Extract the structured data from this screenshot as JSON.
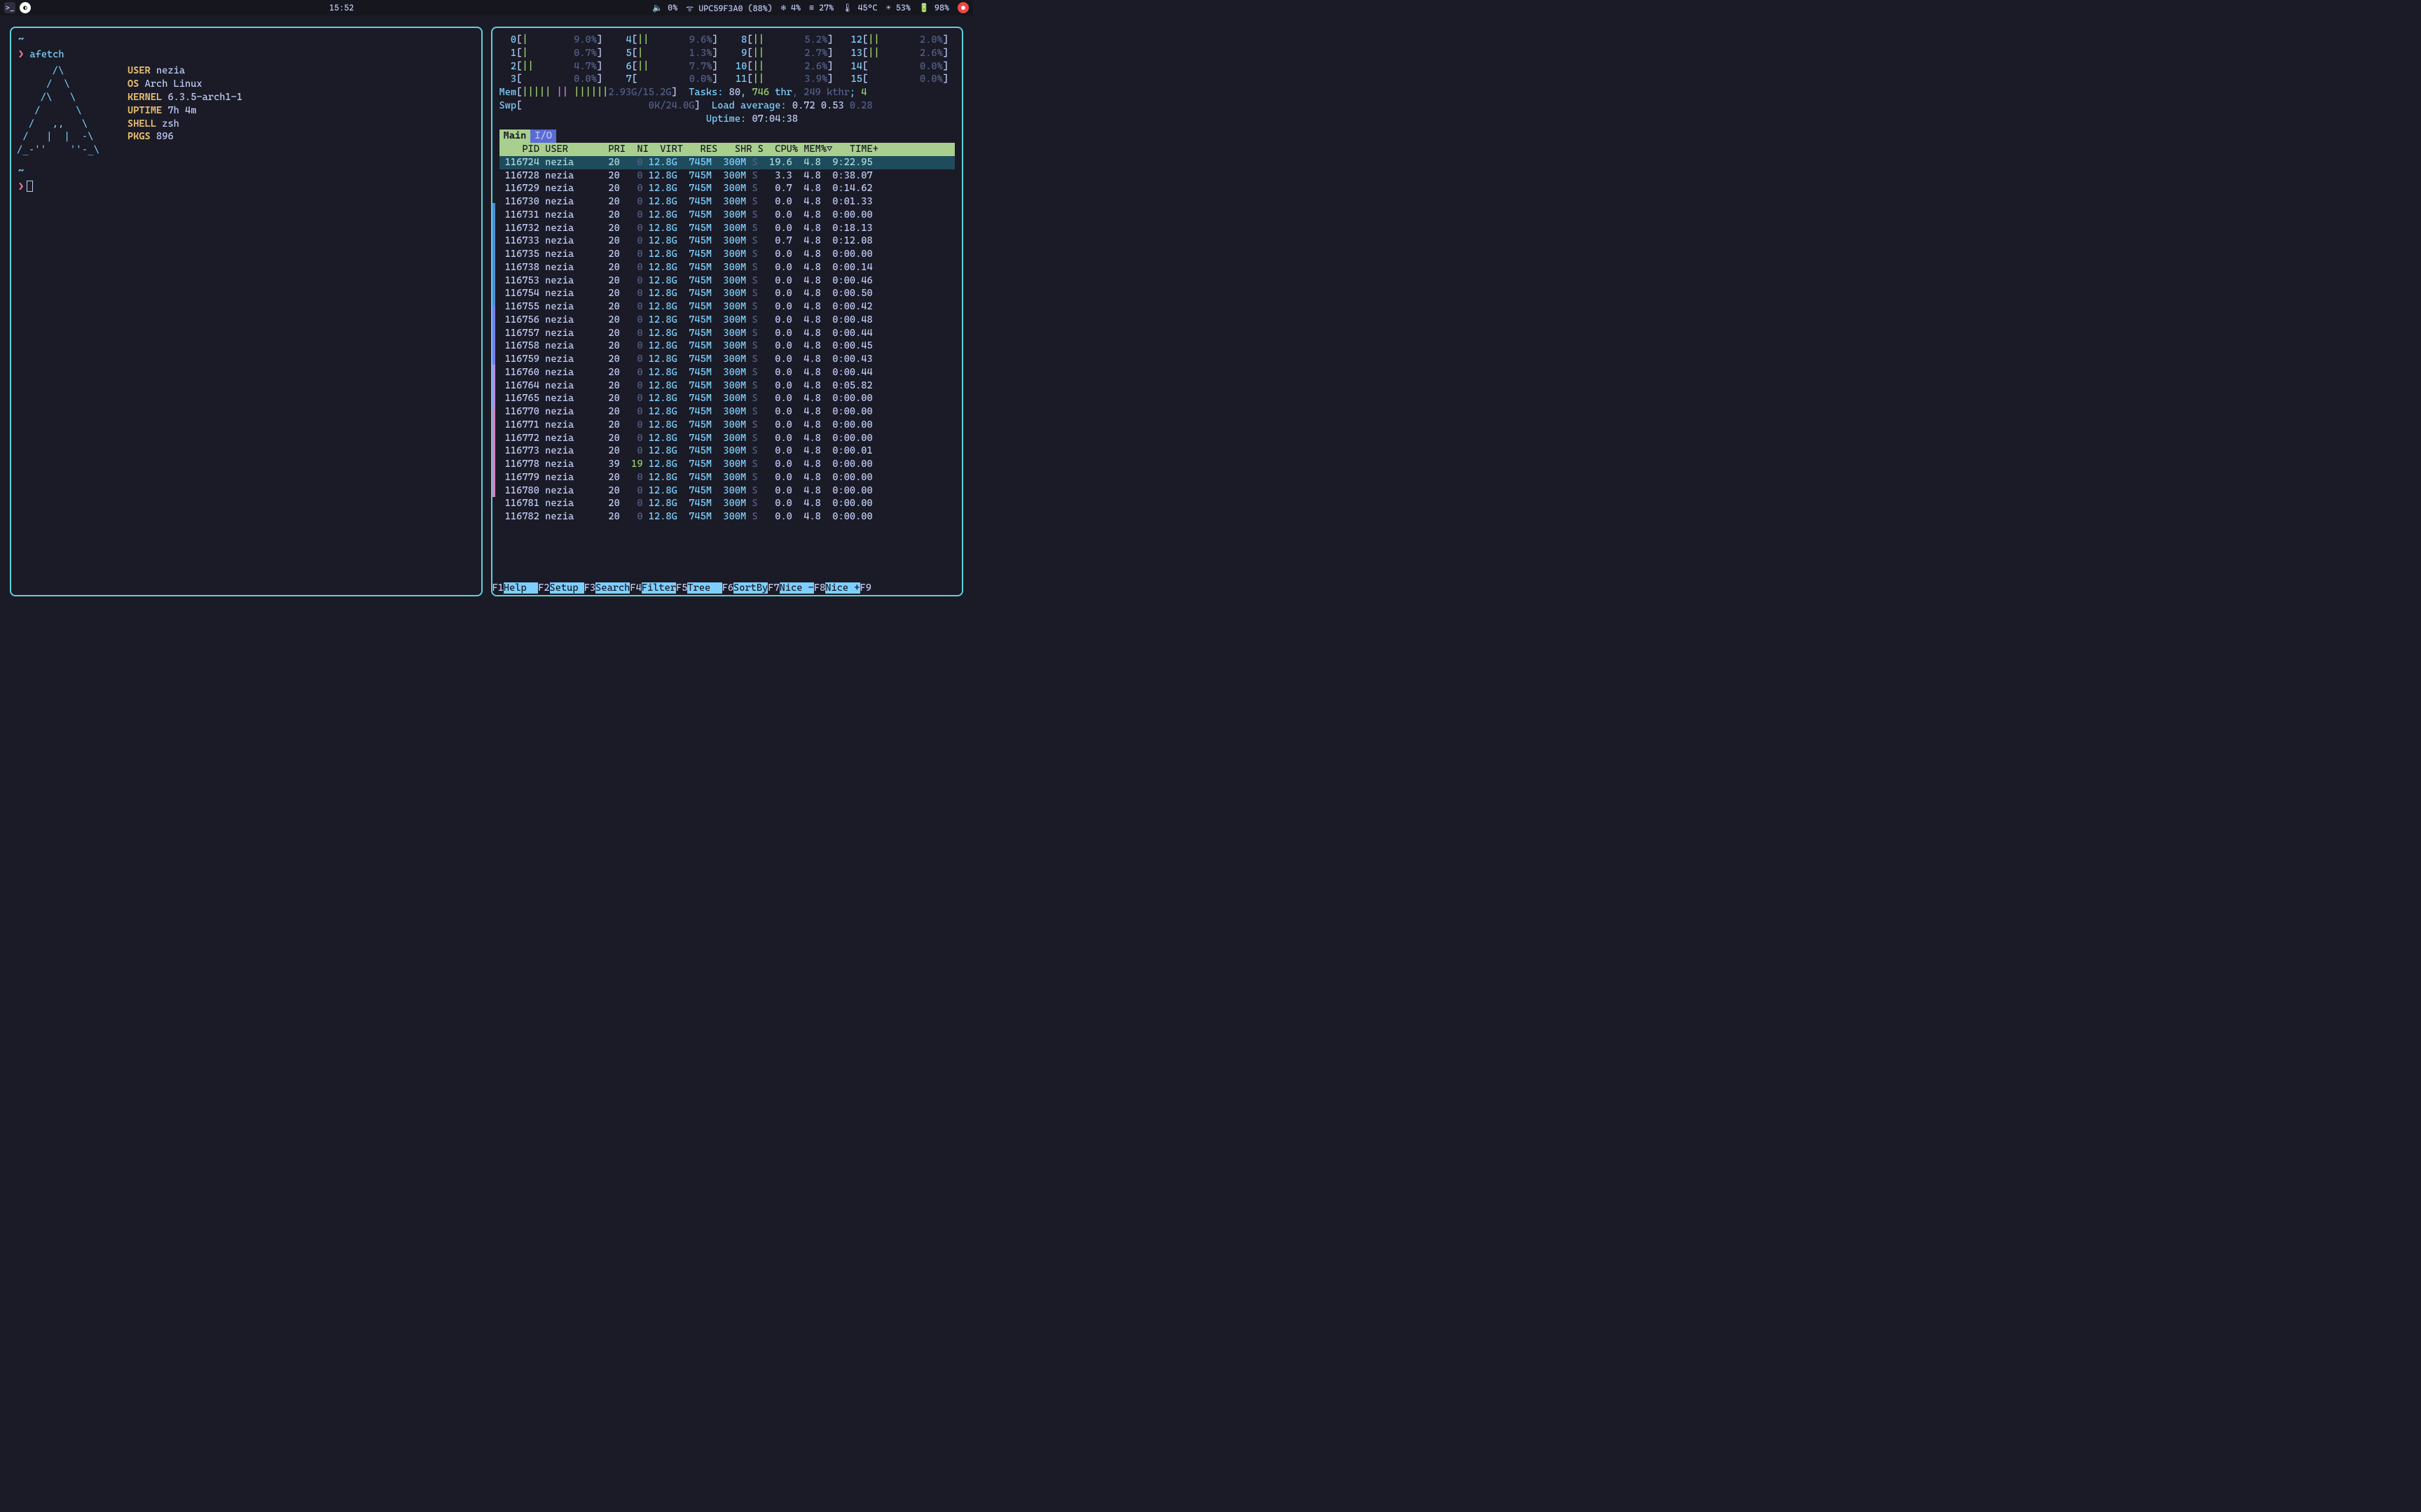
{
  "topbar": {
    "clock": "15:52",
    "volume": "0%",
    "wifi": "UPC59F3A0 (88%)",
    "cpu_icon": "4%",
    "menu_pct": "27%",
    "temp": "45°C",
    "gear_pct": "53%",
    "battery": "98%"
  },
  "left": {
    "command": "afetch",
    "ascii": "      /\\\n     /  \\\n    /\\   \\\n   /      \\\n  /   ,,   \\\n /   |  |  -\\\n/_-''    ''-_\\",
    "info": {
      "USER": "nezia",
      "OS": "Arch Linux",
      "KERNEL": "6.3.5-arch1-1",
      "UPTIME": "7h 4m",
      "SHELL": "zsh",
      "PKGS": "896"
    }
  },
  "htop": {
    "cpus": [
      {
        "n": 0,
        "bar": "|",
        "pct": "9.0%"
      },
      {
        "n": 1,
        "bar": "|",
        "pct": "0.7%"
      },
      {
        "n": 2,
        "bar": "||",
        "pct": "4.7%"
      },
      {
        "n": 3,
        "bar": "",
        "pct": "0.0%"
      },
      {
        "n": 4,
        "bar": "||",
        "pct": "9.6%"
      },
      {
        "n": 5,
        "bar": "|",
        "pct": "1.3%"
      },
      {
        "n": 6,
        "bar": "||",
        "pct": "7.7%"
      },
      {
        "n": 7,
        "bar": "",
        "pct": "0.0%"
      },
      {
        "n": 8,
        "bar": "||",
        "pct": "5.2%"
      },
      {
        "n": 9,
        "bar": "||",
        "pct": "2.7%"
      },
      {
        "n": 10,
        "bar": "||",
        "pct": "2.6%"
      },
      {
        "n": 11,
        "bar": "||",
        "pct": "3.9%"
      },
      {
        "n": 12,
        "bar": "||",
        "pct": "2.0%"
      },
      {
        "n": 13,
        "bar": "||",
        "pct": "2.6%"
      },
      {
        "n": 14,
        "bar": "",
        "pct": "0.0%"
      },
      {
        "n": 15,
        "bar": "",
        "pct": "0.0%"
      }
    ],
    "mem_used": "2.93G",
    "mem_total": "15.2G",
    "swp_used": "0K",
    "swp_total": "24.0G",
    "tasks": "80",
    "threads": "746",
    "kthr": "249",
    "running": "4",
    "load1": "0.72",
    "load5": "0.53",
    "load15": "0.28",
    "uptime": "07:04:38",
    "tabs": {
      "main": "Main",
      "io": "I/O"
    },
    "header": "    PID USER       PRI  NI  VIRT   RES   SHR S  CPU% MEM%▽   TIME+",
    "procs": [
      {
        "pid": "116724",
        "user": "nezia",
        "pri": "20",
        "ni": "0",
        "virt": "12.8G",
        "res": "745M",
        "shr": "300M",
        "s": "S",
        "cpu": "19.6",
        "mem": "4.8",
        "time": "9:22.95",
        "sel": true
      },
      {
        "pid": "116728",
        "user": "nezia",
        "pri": "20",
        "ni": "0",
        "virt": "12.8G",
        "res": "745M",
        "shr": "300M",
        "s": "S",
        "cpu": "3.3",
        "mem": "4.8",
        "time": "0:38.07"
      },
      {
        "pid": "116729",
        "user": "nezia",
        "pri": "20",
        "ni": "0",
        "virt": "12.8G",
        "res": "745M",
        "shr": "300M",
        "s": "S",
        "cpu": "0.7",
        "mem": "4.8",
        "time": "0:14.62"
      },
      {
        "pid": "116730",
        "user": "nezia",
        "pri": "20",
        "ni": "0",
        "virt": "12.8G",
        "res": "745M",
        "shr": "300M",
        "s": "S",
        "cpu": "0.0",
        "mem": "4.8",
        "time": "0:01.33"
      },
      {
        "pid": "116731",
        "user": "nezia",
        "pri": "20",
        "ni": "0",
        "virt": "12.8G",
        "res": "745M",
        "shr": "300M",
        "s": "S",
        "cpu": "0.0",
        "mem": "4.8",
        "time": "0:00.00"
      },
      {
        "pid": "116732",
        "user": "nezia",
        "pri": "20",
        "ni": "0",
        "virt": "12.8G",
        "res": "745M",
        "shr": "300M",
        "s": "S",
        "cpu": "0.0",
        "mem": "4.8",
        "time": "0:18.13"
      },
      {
        "pid": "116733",
        "user": "nezia",
        "pri": "20",
        "ni": "0",
        "virt": "12.8G",
        "res": "745M",
        "shr": "300M",
        "s": "S",
        "cpu": "0.7",
        "mem": "4.8",
        "time": "0:12.08"
      },
      {
        "pid": "116735",
        "user": "nezia",
        "pri": "20",
        "ni": "0",
        "virt": "12.8G",
        "res": "745M",
        "shr": "300M",
        "s": "S",
        "cpu": "0.0",
        "mem": "4.8",
        "time": "0:00.00"
      },
      {
        "pid": "116738",
        "user": "nezia",
        "pri": "20",
        "ni": "0",
        "virt": "12.8G",
        "res": "745M",
        "shr": "300M",
        "s": "S",
        "cpu": "0.0",
        "mem": "4.8",
        "time": "0:00.14"
      },
      {
        "pid": "116753",
        "user": "nezia",
        "pri": "20",
        "ni": "0",
        "virt": "12.8G",
        "res": "745M",
        "shr": "300M",
        "s": "S",
        "cpu": "0.0",
        "mem": "4.8",
        "time": "0:00.46"
      },
      {
        "pid": "116754",
        "user": "nezia",
        "pri": "20",
        "ni": "0",
        "virt": "12.8G",
        "res": "745M",
        "shr": "300M",
        "s": "S",
        "cpu": "0.0",
        "mem": "4.8",
        "time": "0:00.50"
      },
      {
        "pid": "116755",
        "user": "nezia",
        "pri": "20",
        "ni": "0",
        "virt": "12.8G",
        "res": "745M",
        "shr": "300M",
        "s": "S",
        "cpu": "0.0",
        "mem": "4.8",
        "time": "0:00.42"
      },
      {
        "pid": "116756",
        "user": "nezia",
        "pri": "20",
        "ni": "0",
        "virt": "12.8G",
        "res": "745M",
        "shr": "300M",
        "s": "S",
        "cpu": "0.0",
        "mem": "4.8",
        "time": "0:00.48"
      },
      {
        "pid": "116757",
        "user": "nezia",
        "pri": "20",
        "ni": "0",
        "virt": "12.8G",
        "res": "745M",
        "shr": "300M",
        "s": "S",
        "cpu": "0.0",
        "mem": "4.8",
        "time": "0:00.44"
      },
      {
        "pid": "116758",
        "user": "nezia",
        "pri": "20",
        "ni": "0",
        "virt": "12.8G",
        "res": "745M",
        "shr": "300M",
        "s": "S",
        "cpu": "0.0",
        "mem": "4.8",
        "time": "0:00.45"
      },
      {
        "pid": "116759",
        "user": "nezia",
        "pri": "20",
        "ni": "0",
        "virt": "12.8G",
        "res": "745M",
        "shr": "300M",
        "s": "S",
        "cpu": "0.0",
        "mem": "4.8",
        "time": "0:00.43"
      },
      {
        "pid": "116760",
        "user": "nezia",
        "pri": "20",
        "ni": "0",
        "virt": "12.8G",
        "res": "745M",
        "shr": "300M",
        "s": "S",
        "cpu": "0.0",
        "mem": "4.8",
        "time": "0:00.44"
      },
      {
        "pid": "116764",
        "user": "nezia",
        "pri": "20",
        "ni": "0",
        "virt": "12.8G",
        "res": "745M",
        "shr": "300M",
        "s": "S",
        "cpu": "0.0",
        "mem": "4.8",
        "time": "0:05.82"
      },
      {
        "pid": "116765",
        "user": "nezia",
        "pri": "20",
        "ni": "0",
        "virt": "12.8G",
        "res": "745M",
        "shr": "300M",
        "s": "S",
        "cpu": "0.0",
        "mem": "4.8",
        "time": "0:00.00"
      },
      {
        "pid": "116770",
        "user": "nezia",
        "pri": "20",
        "ni": "0",
        "virt": "12.8G",
        "res": "745M",
        "shr": "300M",
        "s": "S",
        "cpu": "0.0",
        "mem": "4.8",
        "time": "0:00.00"
      },
      {
        "pid": "116771",
        "user": "nezia",
        "pri": "20",
        "ni": "0",
        "virt": "12.8G",
        "res": "745M",
        "shr": "300M",
        "s": "S",
        "cpu": "0.0",
        "mem": "4.8",
        "time": "0:00.00"
      },
      {
        "pid": "116772",
        "user": "nezia",
        "pri": "20",
        "ni": "0",
        "virt": "12.8G",
        "res": "745M",
        "shr": "300M",
        "s": "S",
        "cpu": "0.0",
        "mem": "4.8",
        "time": "0:00.00"
      },
      {
        "pid": "116773",
        "user": "nezia",
        "pri": "20",
        "ni": "0",
        "virt": "12.8G",
        "res": "745M",
        "shr": "300M",
        "s": "S",
        "cpu": "0.0",
        "mem": "4.8",
        "time": "0:00.01"
      },
      {
        "pid": "116778",
        "user": "nezia",
        "pri": "39",
        "ni": "19",
        "virt": "12.8G",
        "res": "745M",
        "shr": "300M",
        "s": "S",
        "cpu": "0.0",
        "mem": "4.8",
        "time": "0:00.00"
      },
      {
        "pid": "116779",
        "user": "nezia",
        "pri": "20",
        "ni": "0",
        "virt": "12.8G",
        "res": "745M",
        "shr": "300M",
        "s": "S",
        "cpu": "0.0",
        "mem": "4.8",
        "time": "0:00.00"
      },
      {
        "pid": "116780",
        "user": "nezia",
        "pri": "20",
        "ni": "0",
        "virt": "12.8G",
        "res": "745M",
        "shr": "300M",
        "s": "S",
        "cpu": "0.0",
        "mem": "4.8",
        "time": "0:00.00"
      },
      {
        "pid": "116781",
        "user": "nezia",
        "pri": "20",
        "ni": "0",
        "virt": "12.8G",
        "res": "745M",
        "shr": "300M",
        "s": "S",
        "cpu": "0.0",
        "mem": "4.8",
        "time": "0:00.00"
      },
      {
        "pid": "116782",
        "user": "nezia",
        "pri": "20",
        "ni": "0",
        "virt": "12.8G",
        "res": "745M",
        "shr": "300M",
        "s": "S",
        "cpu": "0.0",
        "mem": "4.8",
        "time": "0:00.00"
      }
    ],
    "fkeys": [
      {
        "k": "F1",
        "l": "Help  "
      },
      {
        "k": "F2",
        "l": "Setup "
      },
      {
        "k": "F3",
        "l": "Search"
      },
      {
        "k": "F4",
        "l": "Filter"
      },
      {
        "k": "F5",
        "l": "Tree  "
      },
      {
        "k": "F6",
        "l": "SortBy"
      },
      {
        "k": "F7",
        "l": "Nice -"
      },
      {
        "k": "F8",
        "l": "Nice +"
      },
      {
        "k": "F9",
        "l": ""
      }
    ]
  }
}
